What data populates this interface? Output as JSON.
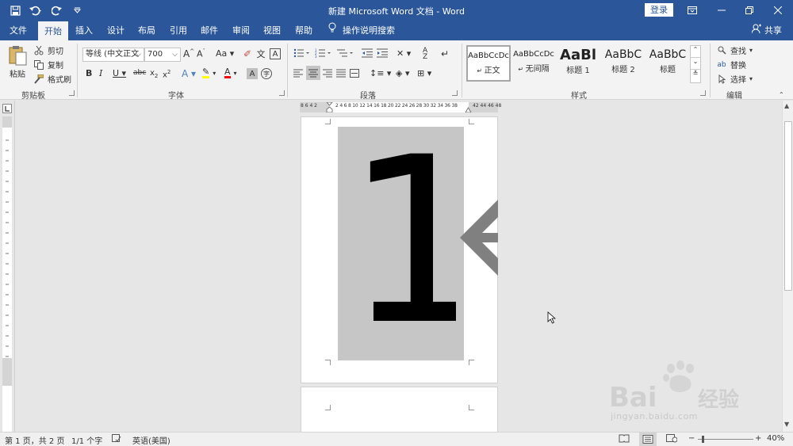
{
  "window": {
    "title": "新建 Microsoft Word 文档 - Word",
    "login_label": "登录"
  },
  "tabs": [
    {
      "label": "文件"
    },
    {
      "label": "开始"
    },
    {
      "label": "插入"
    },
    {
      "label": "设计"
    },
    {
      "label": "布局"
    },
    {
      "label": "引用"
    },
    {
      "label": "邮件"
    },
    {
      "label": "审阅"
    },
    {
      "label": "视图"
    },
    {
      "label": "帮助"
    }
  ],
  "active_tab": "开始",
  "tell_me": "操作说明搜索",
  "share_label": "共享",
  "clipboard": {
    "paste": "粘贴",
    "cut": "剪切",
    "copy": "复制",
    "format_painter": "格式刷",
    "group": "剪贴板"
  },
  "font": {
    "name": "等线 (中文正文",
    "size": "700",
    "group": "字体"
  },
  "paragraph": {
    "group": "段落"
  },
  "styles": {
    "group": "样式",
    "items": [
      {
        "sample": "AaBbCcDc",
        "name": "正文"
      },
      {
        "sample": "AaBbCcDc",
        "name": "无间隔"
      },
      {
        "sample": "AaBl",
        "name": "标题 1"
      },
      {
        "sample": "AaBbC",
        "name": "标题 2"
      },
      {
        "sample": "AaBbC",
        "name": "标题"
      }
    ]
  },
  "editing": {
    "find": "查找",
    "replace": "替换",
    "select": "选择",
    "group": "编辑"
  },
  "ruler": {
    "left_numbers": "8 6 4 2",
    "numbers": "2 4 6 8 10 12 14 16 18 20 22 24 26 28 30 32 34 36 38",
    "right_numbers": "42 44 46 48"
  },
  "document": {
    "big_text": "1"
  },
  "status": {
    "page": "第 1 页，共 2 页",
    "words": "1/1 个字",
    "language": "英语(美国)",
    "zoom": "40%"
  },
  "watermark": {
    "text": "jingyan.baidu.com",
    "logo": "Bai 经验"
  },
  "colors": {
    "ribbon_blue": "#2b579a",
    "highlight_yellow": "#ffff00",
    "font_red": "#ff0000",
    "shape_gray": "#808080"
  }
}
